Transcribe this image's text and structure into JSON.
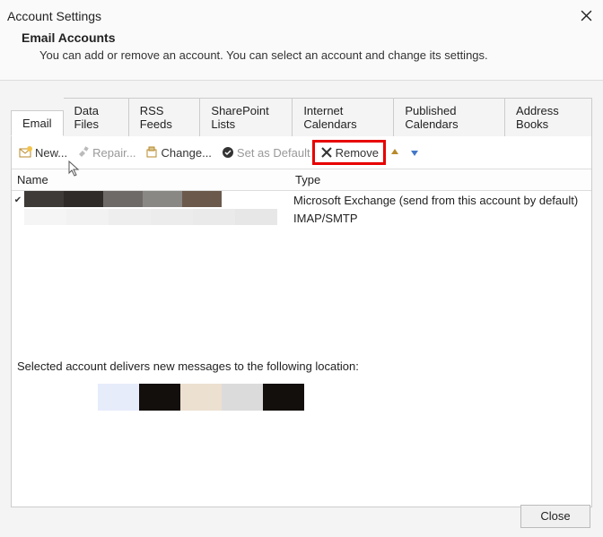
{
  "titlebar": {
    "title": "Account Settings"
  },
  "header": {
    "title": "Email Accounts",
    "desc": "You can add or remove an account. You can select an account and change its settings."
  },
  "tabs": [
    {
      "label": "Email",
      "active": true
    },
    {
      "label": "Data Files",
      "active": false
    },
    {
      "label": "RSS Feeds",
      "active": false
    },
    {
      "label": "SharePoint Lists",
      "active": false
    },
    {
      "label": "Internet Calendars",
      "active": false
    },
    {
      "label": "Published Calendars",
      "active": false
    },
    {
      "label": "Address Books",
      "active": false
    }
  ],
  "toolbar": {
    "new": "New...",
    "repair": "Repair...",
    "change": "Change...",
    "set_default": "Set as Default",
    "remove": "Remove"
  },
  "columns": {
    "name": "Name",
    "type": "Type"
  },
  "accounts": [
    {
      "default": true,
      "name_redacted_colors": [
        "#3e3a37",
        "#2f2b28",
        "#6d6a68",
        "#8a8885",
        "#6b5a4c"
      ],
      "type": "Microsoft Exchange (send from this account by default)"
    },
    {
      "default": false,
      "name_redacted_colors": [
        "#f5f5f5",
        "#f2f2f2",
        "#eeeeee",
        "#ececec",
        "#eaeaea",
        "#e7e7e7"
      ],
      "type": "IMAP/SMTP"
    }
  ],
  "location": {
    "label": "Selected account delivers new messages to the following location:",
    "bar_colors": [
      "#e7ecfb",
      "#130f0c",
      "#ece0d0",
      "#dcdbdc",
      "#130f0c",
      "#ffffff"
    ]
  },
  "footer": {
    "close": "Close"
  }
}
